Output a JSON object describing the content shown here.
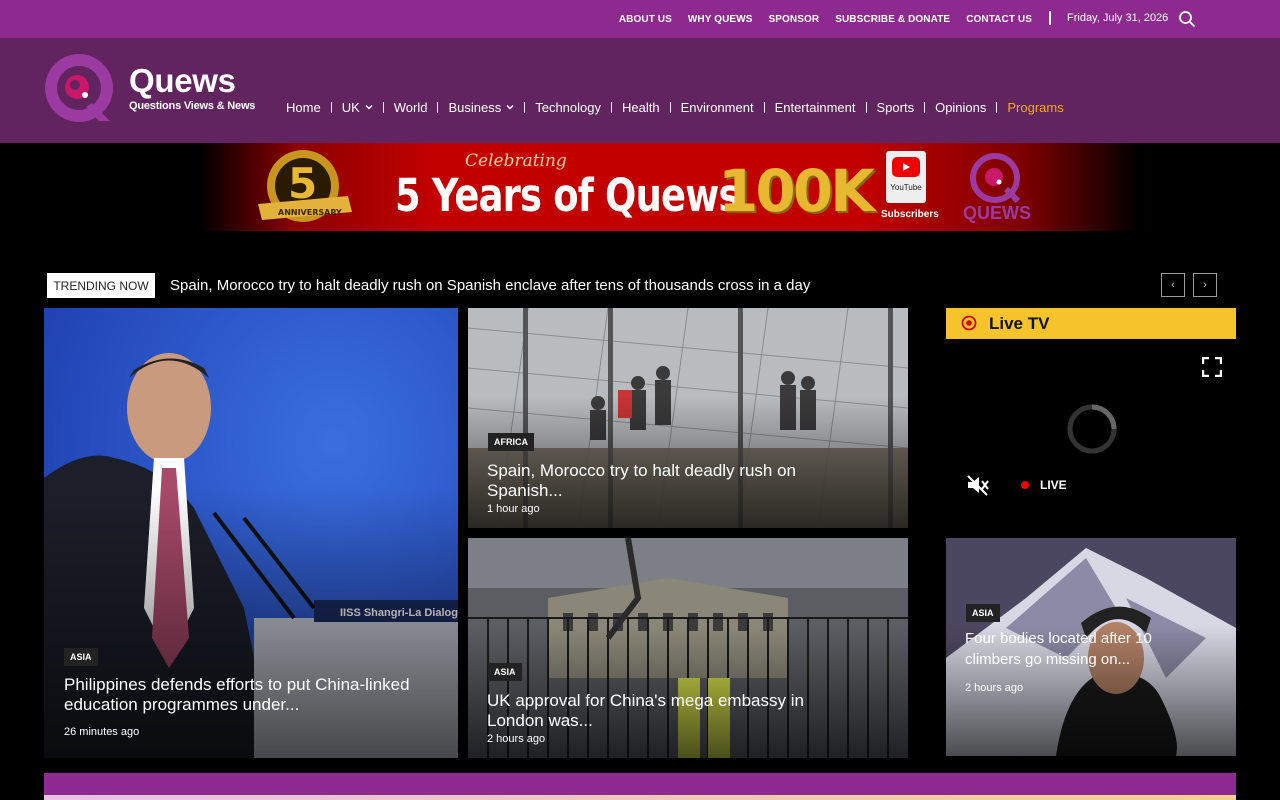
{
  "topbar": {
    "links": [
      "ABOUT US",
      "WHY QUEWS",
      "SPONSOR",
      "SUBSCRIBE & DONATE",
      "CONTACT US"
    ],
    "date": "Friday, July 31, 2026"
  },
  "brand": {
    "name": "Quews",
    "tagline": "Questions Views & News"
  },
  "nav": {
    "home": "Home",
    "uk": "UK",
    "world": "World",
    "business": "Business",
    "technology": "Technology",
    "health": "Health",
    "environment": "Environment",
    "entertainment": "Entertainment",
    "sports": "Sports",
    "opinions": "Opinions",
    "programs": "Programs"
  },
  "banner": {
    "anniversary_badge": "5 Years ANNIVERSARY",
    "celebrating": "Celebrating",
    "headline": "5 Years of Quews",
    "milestone": "100K",
    "youtube": "YouTube",
    "subscribers": "Subscribers",
    "brand": "QUEWS"
  },
  "trending": {
    "label": "TRENDING NOW",
    "text": "Spain, Morocco try to halt deadly rush on Spanish enclave after tens of thousands cross in a day",
    "prev": "‹",
    "next": "›"
  },
  "articles": [
    {
      "category": "ASIA",
      "headline": "Philippines defends efforts to put China-linked education programmes under...",
      "time": "26 minutes ago"
    },
    {
      "category": "AFRICA",
      "headline": "Spain, Morocco try to halt deadly rush on Spanish...",
      "time": "1 hour ago"
    },
    {
      "category": "ASIA",
      "headline": "UK approval for China's mega embassy in London was...",
      "time": "2 hours ago"
    },
    {
      "category": "ASIA",
      "headline": "Four bodies located after 10 climbers go missing on...",
      "time": "2 hours ago"
    }
  ],
  "live": {
    "title": "Live TV",
    "status": "LIVE"
  },
  "colors": {
    "topbar": "#8e2a8f",
    "header": "#62245f",
    "accent": "#f5a623",
    "live": "#f5c42c"
  }
}
